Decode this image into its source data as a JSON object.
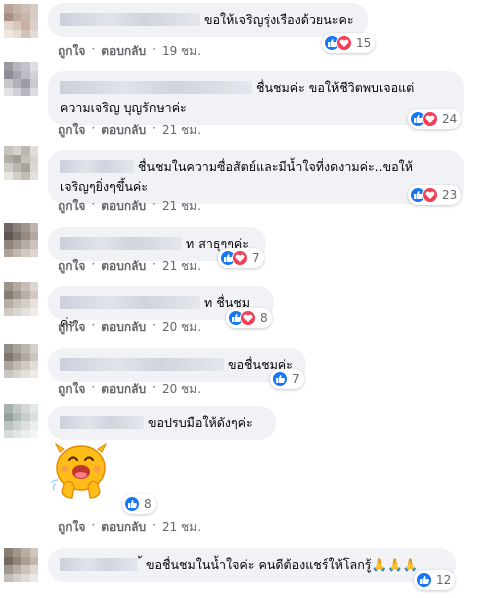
{
  "comments": [
    {
      "text": "ขอให้เจริญรุ่งเรืองด้วยนะคะ",
      "reactions": "15",
      "like": "ถูกใจ",
      "reply": "ตอบกลับ",
      "time": "19 ชม."
    },
    {
      "text_line1": "ชื่นชมค่ะ ขอให้ชีวิตพบเจอแต่",
      "text_line2": "ความเจริญ บุญรักษาค่ะ",
      "reactions": "24",
      "like": "ถูกใจ",
      "reply": "ตอบกลับ",
      "time": "21 ชม."
    },
    {
      "text_line1": "ชื่นชมในความซื่อสัตย์และมีน้ำใจที่งดงามค่ะ..ขอให้",
      "text_line2": "เจริญๆยิ่งๆขึ้นค่ะ",
      "reactions": "23",
      "like": "ถูกใจ",
      "reply": "ตอบกลับ",
      "time": "21 ชม."
    },
    {
      "text": "ท สาธุๆๆค่ะ",
      "reactions": "7",
      "like": "ถูกใจ",
      "reply": "ตอบกลับ",
      "time": "21 ชม."
    },
    {
      "text": "ท ชื่นชมค่ะ",
      "reactions": "8",
      "like": "ถูกใจ",
      "reply": "ตอบกลับ",
      "time": "20 ชม."
    },
    {
      "text": "ขอชื่นชมค่ะ",
      "reactions": "7",
      "like": "ถูกใจ",
      "reply": "ตอบกลับ",
      "time": "20 ชม."
    },
    {
      "text": "ขอปรบมือให้ดังๆค่ะ",
      "reactions": "8",
      "like": "ถูกใจ",
      "reply": "ตอบกลับ",
      "time": "21 ชม."
    },
    {
      "text": "้ ขอชื่นชมในน้ำใจค่ะ คนดีต้องแชร์ให้โลกรู้🙏🙏🙏",
      "reactions": "12",
      "like": "ถูกใจ",
      "reply": "ตอบกลับ",
      "time": "21 ชม."
    }
  ],
  "icons": {
    "like": "thumbs-up-icon",
    "love": "heart-icon",
    "sticker": "clapping-emoji-sticker"
  },
  "colors": {
    "bubble": "#f0f2f5",
    "like": "#1877f2",
    "love": "#f33e58",
    "meta": "#65676b"
  }
}
